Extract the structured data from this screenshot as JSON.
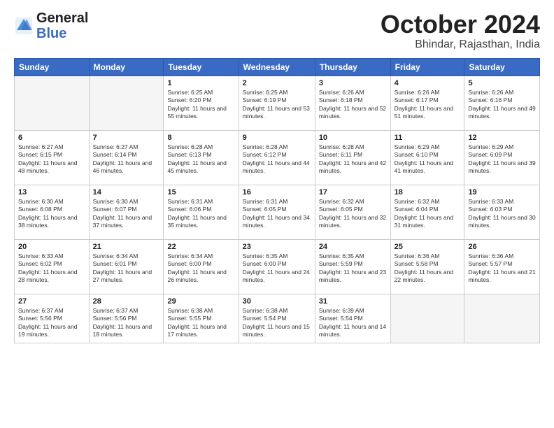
{
  "header": {
    "logo_line1": "General",
    "logo_line2": "Blue",
    "month": "October 2024",
    "location": "Bhindar, Rajasthan, India"
  },
  "columns": [
    "Sunday",
    "Monday",
    "Tuesday",
    "Wednesday",
    "Thursday",
    "Friday",
    "Saturday"
  ],
  "weeks": [
    [
      {
        "day": "",
        "info": ""
      },
      {
        "day": "",
        "info": ""
      },
      {
        "day": "1",
        "info": "Sunrise: 6:25 AM\nSunset: 6:20 PM\nDaylight: 11 hours and 55 minutes."
      },
      {
        "day": "2",
        "info": "Sunrise: 6:25 AM\nSunset: 6:19 PM\nDaylight: 11 hours and 53 minutes."
      },
      {
        "day": "3",
        "info": "Sunrise: 6:26 AM\nSunset: 6:18 PM\nDaylight: 11 hours and 52 minutes."
      },
      {
        "day": "4",
        "info": "Sunrise: 6:26 AM\nSunset: 6:17 PM\nDaylight: 11 hours and 51 minutes."
      },
      {
        "day": "5",
        "info": "Sunrise: 6:26 AM\nSunset: 6:16 PM\nDaylight: 11 hours and 49 minutes."
      }
    ],
    [
      {
        "day": "6",
        "info": "Sunrise: 6:27 AM\nSunset: 6:15 PM\nDaylight: 11 hours and 48 minutes."
      },
      {
        "day": "7",
        "info": "Sunrise: 6:27 AM\nSunset: 6:14 PM\nDaylight: 11 hours and 46 minutes."
      },
      {
        "day": "8",
        "info": "Sunrise: 6:28 AM\nSunset: 6:13 PM\nDaylight: 11 hours and 45 minutes."
      },
      {
        "day": "9",
        "info": "Sunrise: 6:28 AM\nSunset: 6:12 PM\nDaylight: 11 hours and 44 minutes."
      },
      {
        "day": "10",
        "info": "Sunrise: 6:28 AM\nSunset: 6:11 PM\nDaylight: 11 hours and 42 minutes."
      },
      {
        "day": "11",
        "info": "Sunrise: 6:29 AM\nSunset: 6:10 PM\nDaylight: 11 hours and 41 minutes."
      },
      {
        "day": "12",
        "info": "Sunrise: 6:29 AM\nSunset: 6:09 PM\nDaylight: 11 hours and 39 minutes."
      }
    ],
    [
      {
        "day": "13",
        "info": "Sunrise: 6:30 AM\nSunset: 6:08 PM\nDaylight: 11 hours and 38 minutes."
      },
      {
        "day": "14",
        "info": "Sunrise: 6:30 AM\nSunset: 6:07 PM\nDaylight: 11 hours and 37 minutes."
      },
      {
        "day": "15",
        "info": "Sunrise: 6:31 AM\nSunset: 6:06 PM\nDaylight: 11 hours and 35 minutes."
      },
      {
        "day": "16",
        "info": "Sunrise: 6:31 AM\nSunset: 6:05 PM\nDaylight: 11 hours and 34 minutes."
      },
      {
        "day": "17",
        "info": "Sunrise: 6:32 AM\nSunset: 6:05 PM\nDaylight: 11 hours and 32 minutes."
      },
      {
        "day": "18",
        "info": "Sunrise: 6:32 AM\nSunset: 6:04 PM\nDaylight: 11 hours and 31 minutes."
      },
      {
        "day": "19",
        "info": "Sunrise: 6:33 AM\nSunset: 6:03 PM\nDaylight: 11 hours and 30 minutes."
      }
    ],
    [
      {
        "day": "20",
        "info": "Sunrise: 6:33 AM\nSunset: 6:02 PM\nDaylight: 11 hours and 28 minutes."
      },
      {
        "day": "21",
        "info": "Sunrise: 6:34 AM\nSunset: 6:01 PM\nDaylight: 11 hours and 27 minutes."
      },
      {
        "day": "22",
        "info": "Sunrise: 6:34 AM\nSunset: 6:00 PM\nDaylight: 11 hours and 26 minutes."
      },
      {
        "day": "23",
        "info": "Sunrise: 6:35 AM\nSunset: 6:00 PM\nDaylight: 11 hours and 24 minutes."
      },
      {
        "day": "24",
        "info": "Sunrise: 6:35 AM\nSunset: 5:59 PM\nDaylight: 11 hours and 23 minutes."
      },
      {
        "day": "25",
        "info": "Sunrise: 6:36 AM\nSunset: 5:58 PM\nDaylight: 11 hours and 22 minutes."
      },
      {
        "day": "26",
        "info": "Sunrise: 6:36 AM\nSunset: 5:57 PM\nDaylight: 11 hours and 21 minutes."
      }
    ],
    [
      {
        "day": "27",
        "info": "Sunrise: 6:37 AM\nSunset: 5:56 PM\nDaylight: 11 hours and 19 minutes."
      },
      {
        "day": "28",
        "info": "Sunrise: 6:37 AM\nSunset: 5:56 PM\nDaylight: 11 hours and 18 minutes."
      },
      {
        "day": "29",
        "info": "Sunrise: 6:38 AM\nSunset: 5:55 PM\nDaylight: 11 hours and 17 minutes."
      },
      {
        "day": "30",
        "info": "Sunrise: 6:38 AM\nSunset: 5:54 PM\nDaylight: 11 hours and 15 minutes."
      },
      {
        "day": "31",
        "info": "Sunrise: 6:39 AM\nSunset: 5:54 PM\nDaylight: 11 hours and 14 minutes."
      },
      {
        "day": "",
        "info": ""
      },
      {
        "day": "",
        "info": ""
      }
    ]
  ]
}
